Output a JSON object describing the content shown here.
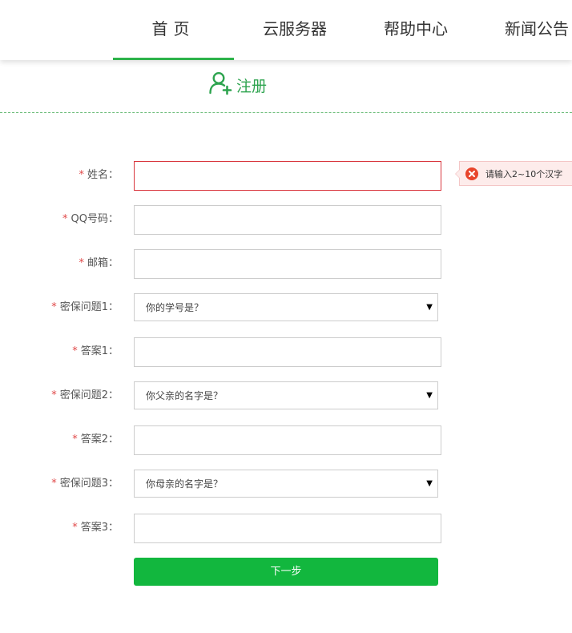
{
  "nav": {
    "items": [
      {
        "label": "首页"
      },
      {
        "label": "云服务器"
      },
      {
        "label": "帮助中心"
      },
      {
        "label": "新闻公告"
      }
    ],
    "active_index": 0
  },
  "register": {
    "title": "注册",
    "icon": "user-add-icon"
  },
  "form": {
    "required_mark": "*",
    "fields": [
      {
        "label": "姓名：",
        "type": "text",
        "value": ""
      },
      {
        "label": "QQ号码：",
        "type": "text",
        "value": ""
      },
      {
        "label": "邮箱：",
        "type": "text",
        "value": ""
      },
      {
        "label": "密保问题1：",
        "type": "select",
        "selected": "你的学号是？"
      },
      {
        "label": "答案1：",
        "type": "text",
        "value": ""
      },
      {
        "label": "密保问题2：",
        "type": "select",
        "selected": "你父亲的名字是？"
      },
      {
        "label": "答案2：",
        "type": "text",
        "value": ""
      },
      {
        "label": "密保问题3：",
        "type": "select",
        "selected": "你母亲的名字是？"
      },
      {
        "label": "答案3：",
        "type": "text",
        "value": ""
      }
    ],
    "error_tip": {
      "text": "请输入2~10个汉字",
      "icon": "error-circle-icon",
      "color": "#e8452c"
    },
    "submit_label": "下一步",
    "submit_color": "#12b73e"
  },
  "colors": {
    "accent": "#2db34a",
    "error": "#d9363e"
  }
}
